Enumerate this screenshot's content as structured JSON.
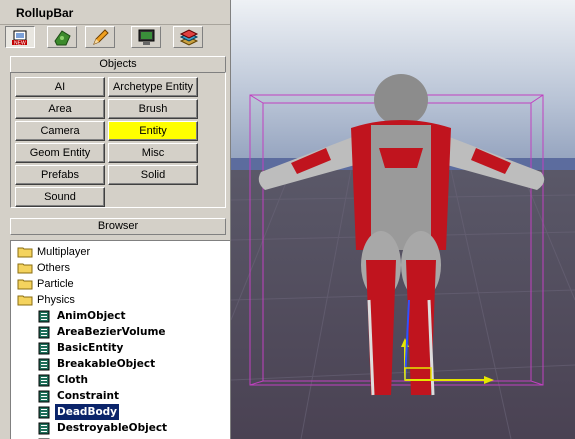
{
  "window": {
    "title": "RollupBar"
  },
  "toolbar": {
    "tabs": [
      {
        "icon": "objects-tab-icon"
      },
      {
        "icon": "terrain-tab-icon"
      },
      {
        "icon": "modify-tab-icon"
      },
      {
        "icon": "display-tab-icon"
      },
      {
        "icon": "layers-tab-icon"
      }
    ]
  },
  "objects": {
    "header": "Objects",
    "buttons": [
      "AI",
      "Archetype Entity",
      "Area",
      "Brush",
      "Camera",
      "Entity",
      "Geom Entity",
      "Misc",
      "Prefabs",
      "Solid",
      "Sound"
    ],
    "selected": "Entity",
    "selected_color": "#ffff00"
  },
  "browser": {
    "header": "Browser",
    "folders": [
      "Multiplayer",
      "Others",
      "Particle",
      "Physics"
    ],
    "physics_items": [
      "AnimObject",
      "AreaBezierVolume",
      "BasicEntity",
      "BreakableObject",
      "Cloth",
      "Constraint",
      "DeadBody",
      "DestroyableObject"
    ],
    "selected_item": "DeadBody",
    "selection_color": "#0a246a"
  },
  "viewport": {
    "sky_color": "#8a9ab8",
    "ground_color": "#4a4253",
    "bounding_box_color": "#c040c0"
  }
}
